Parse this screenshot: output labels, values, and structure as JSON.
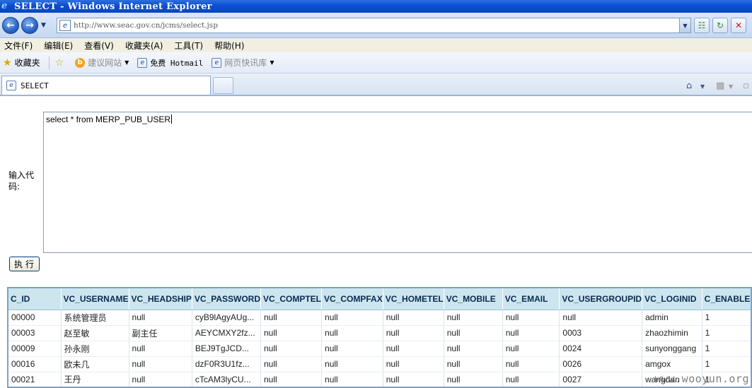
{
  "window": {
    "title": "SELECT - Windows Internet Explorer"
  },
  "address_bar": {
    "url": "http://www.seac.gov.cn/jcms/select.jsp"
  },
  "menu": {
    "items": [
      "文件(F)",
      "编辑(E)",
      "查看(V)",
      "收藏夹(A)",
      "工具(T)",
      "帮助(H)"
    ]
  },
  "favorites_bar": {
    "favorites_label": "收藏夹",
    "suggested_sites": "建议网站",
    "free_hotmail": "免费 Hotmail",
    "web_slice": "网页快讯库"
  },
  "tabs": [
    {
      "label": "SELECT",
      "active": true
    }
  ],
  "form": {
    "code_label": "输入代码:",
    "code_value": "select * from MERP_PUB_USER",
    "execute_label": "执行"
  },
  "result_table": {
    "columns": [
      "C_ID",
      "VC_USERNAME",
      "VC_HEADSHIP",
      "VC_PASSWORD",
      "VC_COMPTEL",
      "VC_COMPFAX",
      "VC_HOMETEL",
      "VC_MOBILE",
      "VC_EMAIL",
      "VC_USERGROUPID",
      "VC_LOGINID",
      "C_ENABLE"
    ],
    "rows": [
      [
        "00000",
        "系统管理员",
        "null",
        "cyB9lAgyAUg...",
        "null",
        "null",
        "null",
        "null",
        "null",
        "null",
        "admin",
        "1"
      ],
      [
        "00003",
        "赵至敏",
        "副主任",
        "AEYCMXY2fz...",
        "null",
        "null",
        "null",
        "null",
        "null",
        "0003",
        "zhaozhimin",
        "1"
      ],
      [
        "00009",
        "孙永刚",
        "null",
        "BEJ9TgJCD...",
        "null",
        "null",
        "null",
        "null",
        "null",
        "0024",
        "sunyonggang",
        "1"
      ],
      [
        "00016",
        "欧未几",
        "null",
        "dzF0R3U1fz...",
        "null",
        "null",
        "null",
        "null",
        "null",
        "0026",
        "amgox",
        "1"
      ],
      [
        "00021",
        "王丹",
        "null",
        "cTcAM3lyCU...",
        "null",
        "null",
        "null",
        "null",
        "null",
        "0027",
        "wangdan",
        "1"
      ]
    ]
  },
  "watermark": "www.wooyun.org"
}
